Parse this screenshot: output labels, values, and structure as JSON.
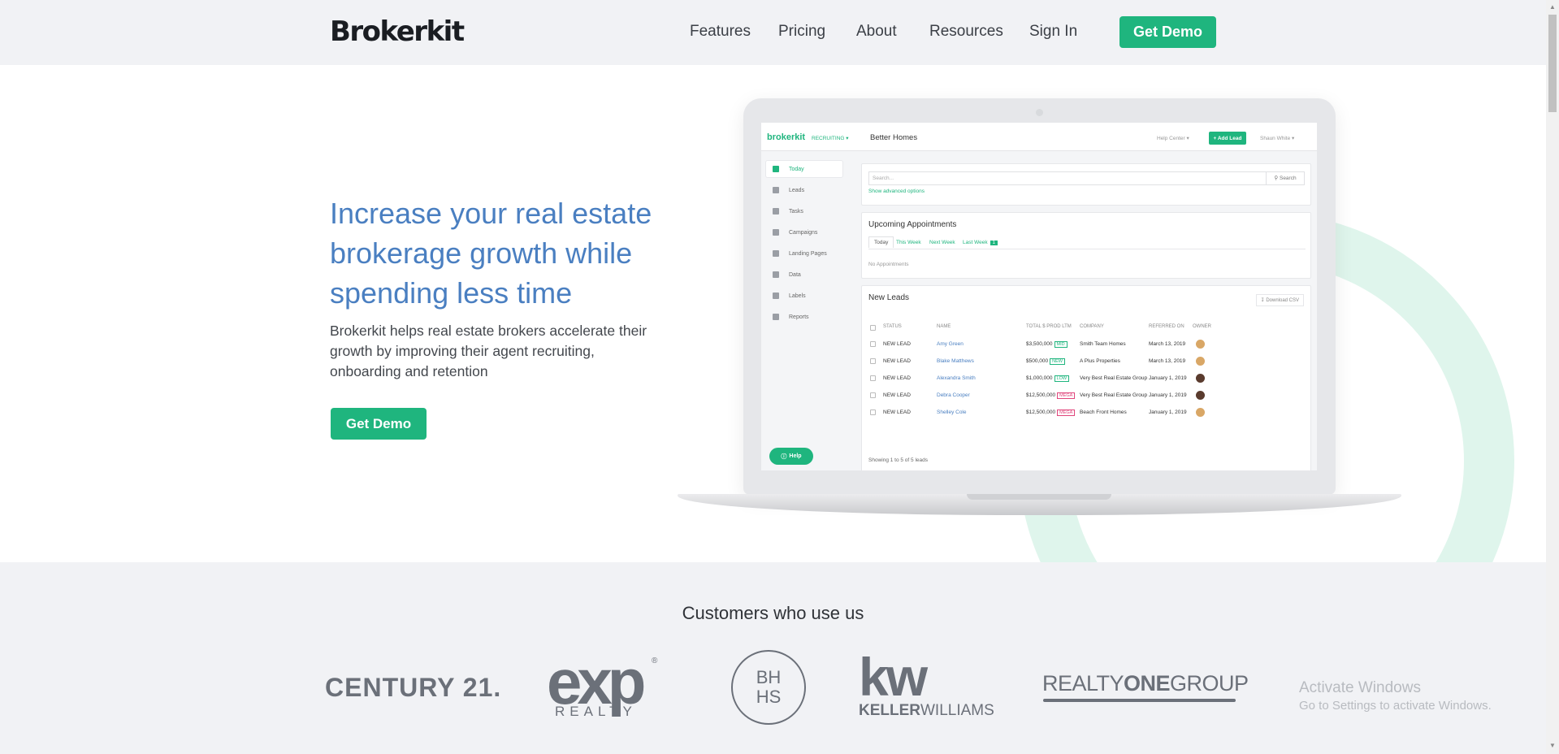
{
  "header": {
    "brand": "Brokerkit",
    "nav": [
      "Features",
      "Pricing",
      "About",
      "Resources",
      "Sign In"
    ],
    "cta": "Get Demo"
  },
  "hero": {
    "title": "Increase your real estate brokerage growth while spending less time",
    "subtitle": "Brokerkit helps real estate brokers accelerate their growth by improving their agent recruiting, onboarding and retention",
    "cta": "Get Demo"
  },
  "app": {
    "logo": "brokerkit",
    "mode": "RECRUITING ▾",
    "org": "Better Homes",
    "help_center": "Help Center ▾",
    "add_lead": "+ Add Lead",
    "user": "Shaun White ▾",
    "sidebar": [
      "Today",
      "Leads",
      "Tasks",
      "Campaigns",
      "Landing Pages",
      "Data",
      "Labels",
      "Reports"
    ],
    "help_button": "Help",
    "search": {
      "placeholder": "Search...",
      "button": "Search",
      "advanced": "Show advanced options"
    },
    "appointments": {
      "title": "Upcoming Appointments",
      "tabs": [
        "Today",
        "This Week",
        "Next Week",
        "Last Week"
      ],
      "last_week_count": "1",
      "empty": "No Appointments"
    },
    "leads": {
      "title": "New Leads",
      "download": "Download CSV",
      "columns": [
        "STATUS",
        "NAME",
        "TOTAL $ PROD LTM",
        "COMPANY",
        "REFERRED ON",
        "OWNER"
      ],
      "rows": [
        {
          "status": "NEW LEAD",
          "name": "Amy Green",
          "prod": "$3,500,000",
          "tag": "MID",
          "company": "Smith Team Homes",
          "referred": "March 13, 2019"
        },
        {
          "status": "NEW LEAD",
          "name": "Blake Matthews",
          "prod": "$500,000",
          "tag": "NEW",
          "company": "A Plus Properties",
          "referred": "March 13, 2019"
        },
        {
          "status": "NEW LEAD",
          "name": "Alexandra Smith",
          "prod": "$1,000,000",
          "tag": "LOW",
          "company": "Very Best Real Estate Group",
          "referred": "January 1, 2019"
        },
        {
          "status": "NEW LEAD",
          "name": "Debra Cooper",
          "prod": "$12,500,000",
          "tag": "MEGA",
          "company": "Very Best Real Estate Group",
          "referred": "January 1, 2019"
        },
        {
          "status": "NEW LEAD",
          "name": "Shelley Cole",
          "prod": "$12,500,000",
          "tag": "MEGA",
          "company": "Beach Front Homes",
          "referred": "January 1, 2019"
        }
      ],
      "showing": "Showing 1 to 5 of 5 leads"
    }
  },
  "customers": {
    "title": "Customers who use us",
    "logos": {
      "century21": "CENTURY 21.",
      "exp": "exp",
      "exp_sub": "REALTY",
      "exp_reg": "®",
      "bhhs_top": "BH",
      "bhhs_bottom": "HS",
      "kw": "kw",
      "kw_bold": "KELLER",
      "kw_light": "WILLIAMS",
      "realty_one_a": "REALTY",
      "realty_one_b": "ONE",
      "realty_one_c": "GROUP"
    }
  },
  "windows_notice": {
    "line1": "Activate Windows",
    "line2": "Go to Settings to activate Windows."
  },
  "colors": {
    "accent": "#1fb57e",
    "headline": "#4a7fc1",
    "logo_gray": "#6b7079"
  }
}
